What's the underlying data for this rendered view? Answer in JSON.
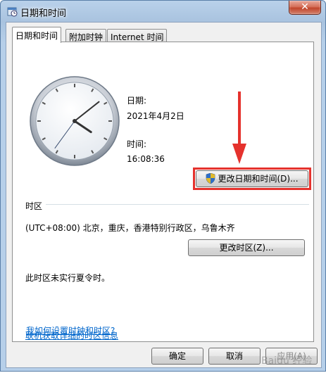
{
  "window": {
    "title": "日期和时间",
    "close_label": "✕"
  },
  "tabs": [
    {
      "label": "日期和时间",
      "active": true
    },
    {
      "label": "附加时钟",
      "active": false
    },
    {
      "label": "Internet 时间",
      "active": false
    }
  ],
  "clock": {
    "time": "16:08:36"
  },
  "datetime": {
    "date_label": "日期:",
    "date_value": "2021年4月2日",
    "time_label": "时间:",
    "time_value": "16:08:36",
    "change_button": "更改日期和时间(D)..."
  },
  "timezone": {
    "section_label": "时区",
    "value": "(UTC+08:00) 北京，重庆，香港特别行政区，乌鲁木齐",
    "change_button": "更改时区(Z)...",
    "dst_note": "此时区未实行夏令时。"
  },
  "links": {
    "online_info": "联机获取详细的时区信息",
    "how_to": "我如何设置时钟和时区?"
  },
  "footer": {
    "ok": "确定",
    "cancel": "取消",
    "apply": "应用(A)"
  },
  "annotation": {
    "highlight_color": "#e5322d"
  },
  "watermark": {
    "text": "Baidu 经验"
  }
}
